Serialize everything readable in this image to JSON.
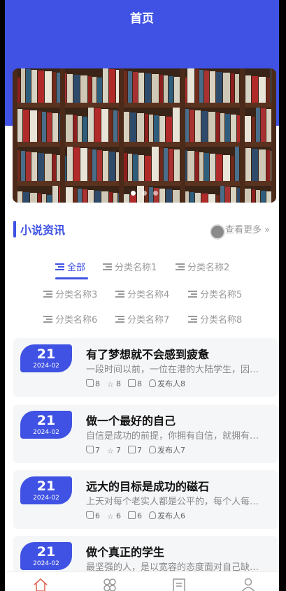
{
  "header": {
    "title": "首页"
  },
  "banner": {
    "slides": 3,
    "active_index": 0
  },
  "section": {
    "title": "小说资讯",
    "more_label": "查看更多 »"
  },
  "categories": [
    {
      "label": "全部",
      "active": true
    },
    {
      "label": "分类名称1",
      "active": false
    },
    {
      "label": "分类名称2",
      "active": false
    },
    {
      "label": "分类名称3",
      "active": false
    },
    {
      "label": "分类名称4",
      "active": false
    },
    {
      "label": "分类名称5",
      "active": false
    },
    {
      "label": "分类名称6",
      "active": false
    },
    {
      "label": "分类名称7",
      "active": false
    },
    {
      "label": "分类名称8",
      "active": false
    }
  ],
  "articles": [
    {
      "day": "21",
      "ym": "2024-02",
      "title": "有了梦想就不会感到疲惫",
      "desc": "一段时间以前，一位在港的大陆学生，因为家境贫寒而来港打工",
      "likes": "8",
      "favorites": "8",
      "views": "8",
      "publisher": "发布人8"
    },
    {
      "day": "21",
      "ym": "2024-02",
      "title": "做一个最好的自己",
      "desc": "自信是成功的前提，你拥有自信，就拥有了成功的一半",
      "likes": "7",
      "favorites": "7",
      "views": "7",
      "publisher": "发布人7"
    },
    {
      "day": "21",
      "ym": "2024-02",
      "title": "远大的目标是成功的磁石",
      "desc": "上天对每个老实人都是公平的，每个人每天都有二十四小时",
      "likes": "6",
      "favorites": "6",
      "views": "6",
      "publisher": "发布人6"
    },
    {
      "day": "21",
      "ym": "2024-02",
      "title": "做个真正的学生",
      "desc": "最坚强的人，是以宽容的态度面对自己缺点的人",
      "likes": "",
      "favorites": "",
      "views": "",
      "publisher": ""
    }
  ],
  "tabbar": {
    "icons": [
      "home-icon",
      "category-icon",
      "list-icon",
      "user-icon"
    ],
    "active_color": "#e06a55"
  },
  "colors": {
    "accent": "#3f52e3"
  }
}
